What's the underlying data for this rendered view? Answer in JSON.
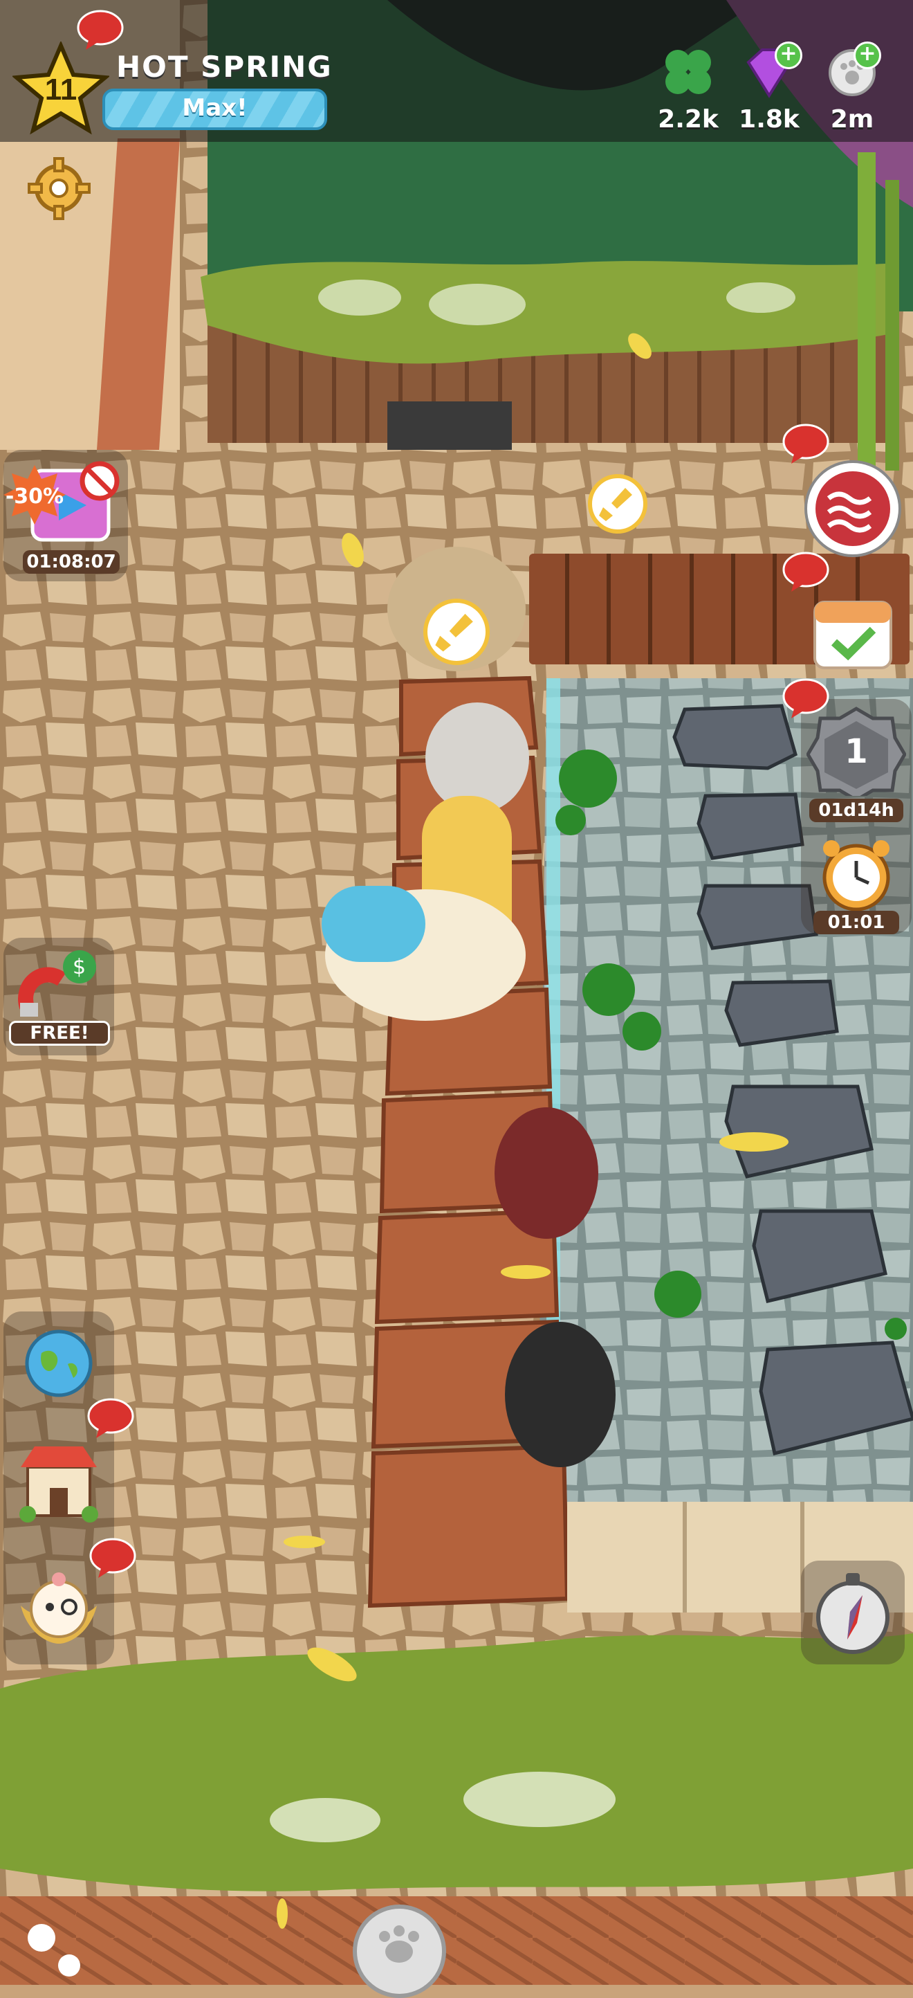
{
  "hud": {
    "level": "11",
    "area_name": "HOT SPRING",
    "xp_label": "Max!",
    "currencies": [
      {
        "name": "clover",
        "icon": "clover-icon",
        "value": "2.2k"
      },
      {
        "name": "gem",
        "icon": "gem-icon",
        "value": "1.8k"
      },
      {
        "name": "paw-coin",
        "icon": "paw-coin-icon",
        "value": "2m"
      }
    ]
  },
  "left_buttons": {
    "sale": {
      "discount": "-30%",
      "timer": "01:08:07"
    },
    "magnet": {
      "label": "FREE!"
    }
  },
  "right_buttons": {
    "rank": {
      "number": "1",
      "timer": "01d14h"
    },
    "clock": {
      "timer": "01:01"
    }
  },
  "colors": {
    "accent_blue": "#5ec3e6",
    "badge_red": "#d9322e",
    "panel_brown": "#5a3b28"
  }
}
